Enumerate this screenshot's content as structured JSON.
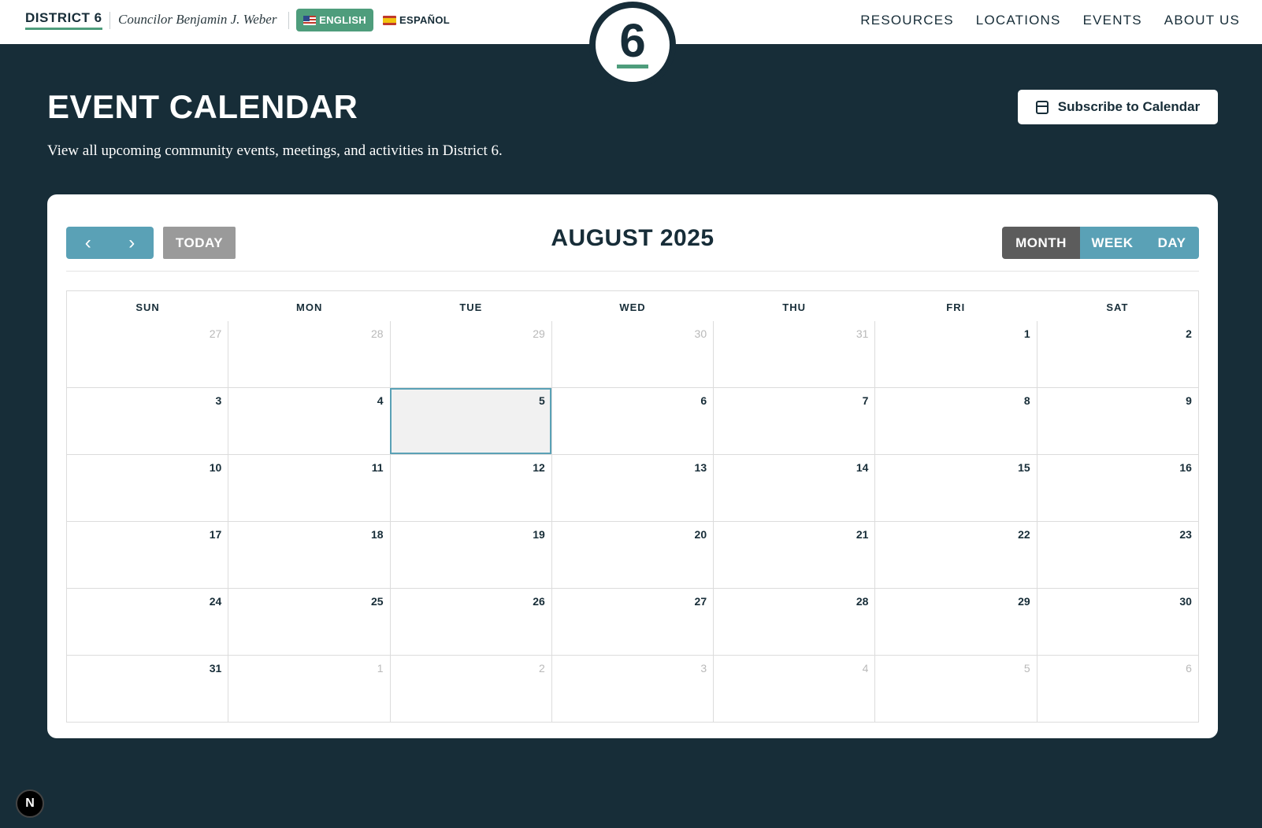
{
  "header": {
    "brand": "DISTRICT 6",
    "councilor": "Councilor Benjamin J. Weber",
    "languages": [
      {
        "label": "ENGLISH",
        "flag": "us-flag-icon",
        "active": true
      },
      {
        "label": "ESPAÑOL",
        "flag": "spain-flag-icon",
        "active": false
      }
    ],
    "logo_number": "6",
    "nav": [
      "RESOURCES",
      "LOCATIONS",
      "EVENTS",
      "ABOUT US"
    ]
  },
  "page": {
    "title": "EVENT CALENDAR",
    "description": "View all upcoming community events, meetings, and activities in District 6.",
    "subscribe_label": "Subscribe to Calendar"
  },
  "calendar": {
    "prev_icon": "‹",
    "next_icon": "›",
    "today_label": "TODAY",
    "month_title": "AUGUST 2025",
    "views": [
      "MONTH",
      "WEEK",
      "DAY"
    ],
    "active_view": "MONTH",
    "weekdays": [
      "SUN",
      "MON",
      "TUE",
      "WED",
      "THU",
      "FRI",
      "SAT"
    ],
    "weeks": [
      [
        {
          "d": "27",
          "o": true
        },
        {
          "d": "28",
          "o": true
        },
        {
          "d": "29",
          "o": true
        },
        {
          "d": "30",
          "o": true
        },
        {
          "d": "31",
          "o": true
        },
        {
          "d": "1"
        },
        {
          "d": "2"
        }
      ],
      [
        {
          "d": "3"
        },
        {
          "d": "4"
        },
        {
          "d": "5",
          "today": true
        },
        {
          "d": "6"
        },
        {
          "d": "7"
        },
        {
          "d": "8"
        },
        {
          "d": "9"
        }
      ],
      [
        {
          "d": "10"
        },
        {
          "d": "11"
        },
        {
          "d": "12"
        },
        {
          "d": "13"
        },
        {
          "d": "14"
        },
        {
          "d": "15"
        },
        {
          "d": "16"
        }
      ],
      [
        {
          "d": "17"
        },
        {
          "d": "18"
        },
        {
          "d": "19"
        },
        {
          "d": "20"
        },
        {
          "d": "21"
        },
        {
          "d": "22"
        },
        {
          "d": "23"
        }
      ],
      [
        {
          "d": "24"
        },
        {
          "d": "25"
        },
        {
          "d": "26"
        },
        {
          "d": "27"
        },
        {
          "d": "28"
        },
        {
          "d": "29"
        },
        {
          "d": "30"
        }
      ],
      [
        {
          "d": "31"
        },
        {
          "d": "1",
          "o": true
        },
        {
          "d": "2",
          "o": true
        },
        {
          "d": "3",
          "o": true
        },
        {
          "d": "4",
          "o": true
        },
        {
          "d": "5",
          "o": true
        },
        {
          "d": "6",
          "o": true
        }
      ]
    ]
  },
  "devtools_badge": "N",
  "colors": {
    "background": "#172d38",
    "accent_green": "#4e9d7c",
    "accent_blue": "#5aa1b6",
    "active_view": "#5c5c5c",
    "today_button": "#9a9a9a"
  }
}
